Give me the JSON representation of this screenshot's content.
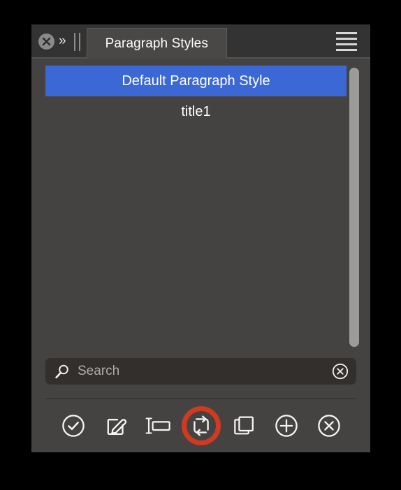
{
  "window": {
    "background_color": "#000000",
    "panel_color": "#454341",
    "titlebar_color": "#333333",
    "accent_selected_color": "#3b68d4",
    "highlight_ring_color": "#cf3a20"
  },
  "titlebar": {
    "close_icon": "close-icon",
    "collapse_icon": "double-chevron-right-icon",
    "grip_icon": "drag-handle-icon",
    "menu_icon": "hamburger-menu-icon",
    "tab": {
      "label": "Paragraph Styles"
    }
  },
  "style_list": {
    "items": [
      {
        "label": "Default Paragraph Style",
        "selected": true
      },
      {
        "label": "title1",
        "selected": false
      }
    ],
    "scrollbar": {
      "name": "vertical-scrollbar"
    }
  },
  "search": {
    "placeholder": "Search",
    "value": "",
    "search_icon": "search-icon",
    "clear_icon": "clear-icon"
  },
  "toolbar": {
    "buttons": [
      {
        "name": "apply-style-button",
        "icon": "check-circle-icon",
        "label": "Apply Style",
        "highlighted": false
      },
      {
        "name": "edit-style-button",
        "icon": "edit-pencil-icon",
        "label": "Edit Style",
        "highlighted": false
      },
      {
        "name": "spacing-style-button",
        "icon": "paragraph-spacing-icon",
        "label": "Paragraph Settings",
        "highlighted": false
      },
      {
        "name": "update-style-button",
        "icon": "refresh-update-icon",
        "label": "Update Style",
        "highlighted": true
      },
      {
        "name": "new-from-selection-button",
        "icon": "copy-squares-icon",
        "label": "New Style from Selection",
        "highlighted": false
      },
      {
        "name": "add-style-button",
        "icon": "plus-circle-icon",
        "label": "Add Style",
        "highlighted": false
      },
      {
        "name": "delete-style-button",
        "icon": "close-circle-icon",
        "label": "Delete Style",
        "highlighted": false
      }
    ]
  }
}
